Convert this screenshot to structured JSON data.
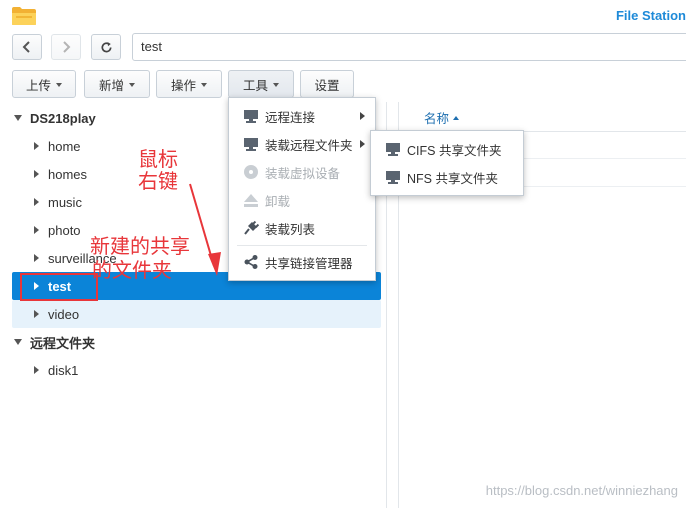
{
  "app": {
    "title": "File Station"
  },
  "nav": {
    "back": "back",
    "forward": "forward",
    "refresh": "refresh"
  },
  "address": {
    "value": "test"
  },
  "toolbar": {
    "upload_label": "上传",
    "new_label": "新增",
    "action_label": "操作",
    "tools_label": "工具",
    "settings_label": "设置"
  },
  "tree": {
    "root1": "DS218play",
    "folders": [
      "home",
      "homes",
      "music",
      "photo",
      "surveillance",
      "test",
      "video"
    ],
    "root2": "远程文件夹",
    "remote_folders": [
      "disk1"
    ]
  },
  "list": {
    "col_name": "名称"
  },
  "tools_menu": {
    "items": [
      "远程连接",
      "装载远程文件夹",
      "装载虚拟设备",
      "卸载",
      "装载列表",
      "共享链接管理器"
    ]
  },
  "submenu": {
    "items": [
      "CIFS 共享文件夹",
      "NFS 共享文件夹"
    ]
  },
  "annotations": {
    "right_click_line1": "鼠标",
    "right_click_line2": "右键",
    "new_share_line1": "新建的共享",
    "new_share_line2": "的文件夹"
  },
  "watermark": "https://blog.csdn.net/winniezhang",
  "colors": {
    "accent": "#0b84d8",
    "annotation": "#e8363a",
    "title": "#1e8ad8"
  },
  "icons": {
    "app": "folder-icon",
    "remote_connect": "computer-icon",
    "mount_remote": "computer-icon",
    "mount_virtual": "disc-icon",
    "unmount": "eject-icon",
    "mount_list": "plug-icon",
    "share_link": "share-icon"
  }
}
